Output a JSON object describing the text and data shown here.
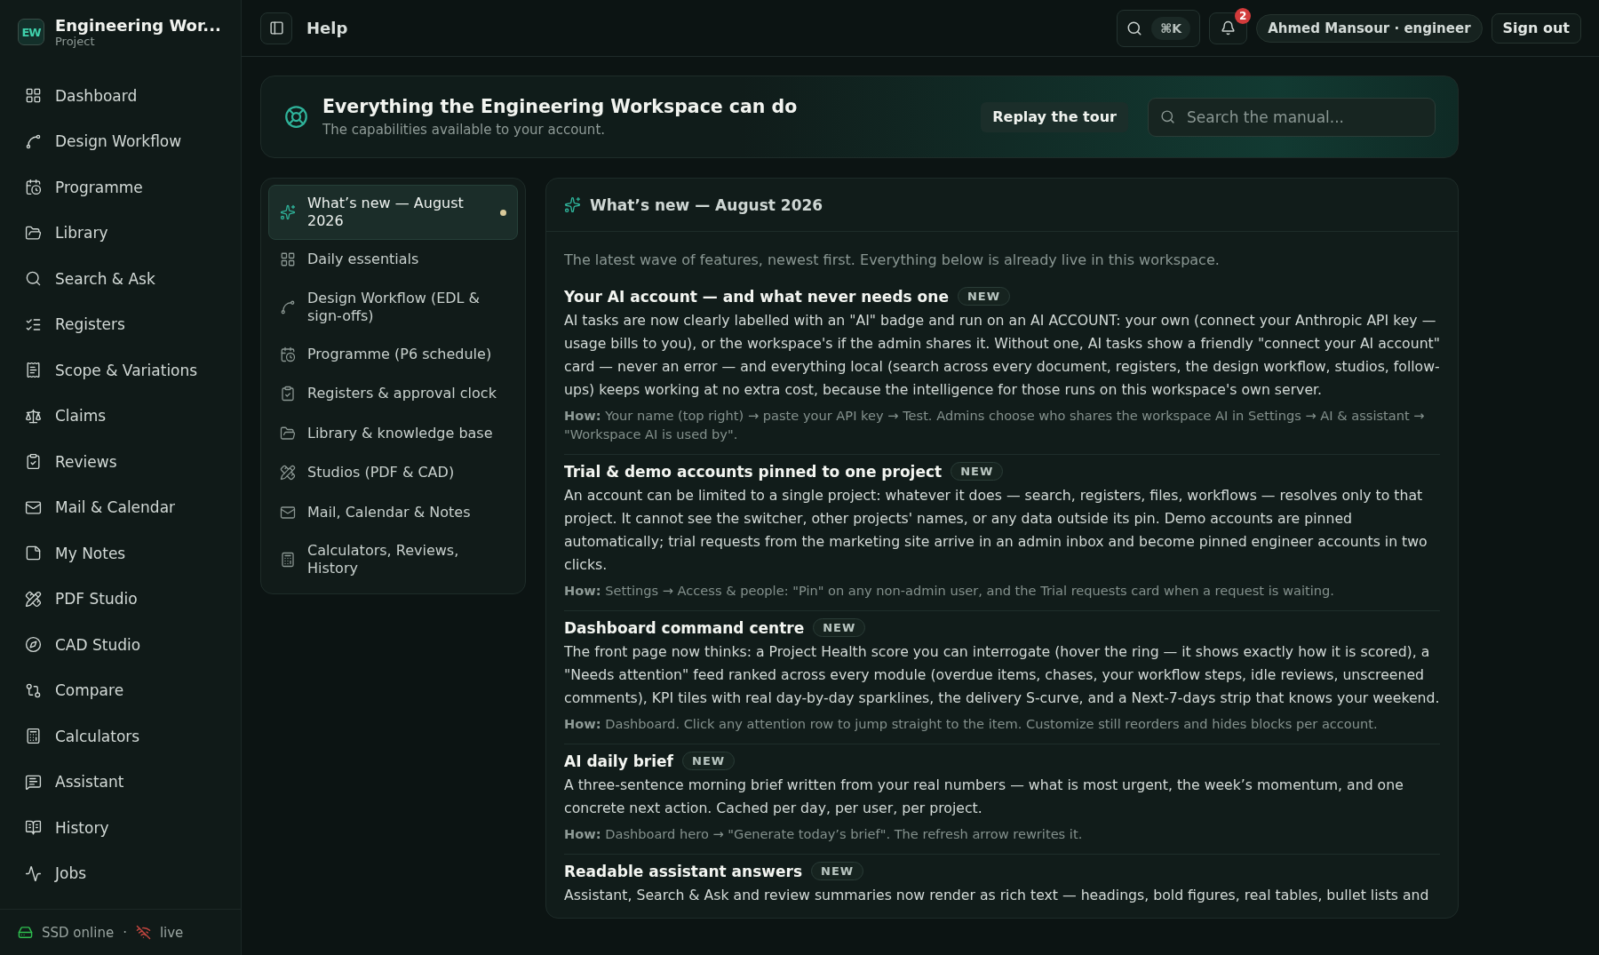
{
  "brand": {
    "initials": "EW",
    "name": "Engineering Wor...",
    "subtitle": "Project"
  },
  "sidebar": {
    "items": [
      {
        "label": "Dashboard",
        "selected": false
      },
      {
        "label": "Design Workflow",
        "selected": false
      },
      {
        "label": "Programme",
        "selected": false
      },
      {
        "label": "Library",
        "selected": false
      },
      {
        "label": "Search & Ask",
        "selected": false
      },
      {
        "label": "Registers",
        "selected": false
      },
      {
        "label": "Scope & Variations",
        "selected": false
      },
      {
        "label": "Claims",
        "selected": false
      },
      {
        "label": "Reviews",
        "selected": false
      },
      {
        "label": "Mail & Calendar",
        "selected": false
      },
      {
        "label": "My Notes",
        "selected": false
      },
      {
        "label": "PDF Studio",
        "selected": false
      },
      {
        "label": "CAD Studio",
        "selected": false
      },
      {
        "label": "Compare",
        "selected": false
      },
      {
        "label": "Calculators",
        "selected": false
      },
      {
        "label": "Assistant",
        "selected": false
      },
      {
        "label": "History",
        "selected": false
      },
      {
        "label": "Jobs",
        "selected": false
      }
    ],
    "status": {
      "storage": "SSD online",
      "storage_ok": true,
      "separator": "·",
      "live": "live",
      "live_ok": false
    }
  },
  "topbar": {
    "title": "Help",
    "shortcut": "⌘K",
    "notifications": "2",
    "user": "Ahmed Mansour · engineer",
    "sign_out": "Sign out"
  },
  "header": {
    "title": "Everything the Engineering Workspace can do",
    "subtitle": "The capabilities available to your account.",
    "button": "Replay the tour",
    "search": {
      "placeholder": "Search the manual..."
    }
  },
  "toc": [
    {
      "label": "What’s new — August 2026",
      "selected": true
    },
    {
      "label": "Daily essentials",
      "selected": false
    },
    {
      "label": "Design Workflow (EDL & sign-offs)",
      "selected": false
    },
    {
      "label": "Programme (P6 schedule)",
      "selected": false
    },
    {
      "label": "Registers & approval clock",
      "selected": false
    },
    {
      "label": "Library & knowledge base",
      "selected": false
    },
    {
      "label": "Studios (PDF & CAD)",
      "selected": false
    },
    {
      "label": "Mail, Calendar & Notes",
      "selected": false
    },
    {
      "label": "Calculators, Reviews, History",
      "selected": false
    }
  ],
  "article": {
    "title": "What’s new — August 2026",
    "intro": "The latest wave of features, newest first. Everything below is already live in this workspace.",
    "sections": [
      {
        "title": "Your AI account — and what never needs one",
        "badge": "NEW",
        "body": "AI tasks are now clearly labelled with an \"AI\" badge and run on an AI ACCOUNT: your own (connect your Anthropic API key — usage bills to you), or the workspace's if the admin shares it. Without one, AI tasks show a friendly \"connect your AI account\" card — never an error — and everything local (search across every document, registers, the design workflow, studios, follow-ups) keeps working at no extra cost, because the intelligence for those runs on this workspace's own server.",
        "how": "**How:** Your name (top right) → paste your API key → Test. Admins choose who shares the workspace AI in Settings → AI & assistant → \"Workspace AI is used by\"."
      },
      {
        "title": "Trial & demo accounts pinned to one project",
        "badge": "NEW",
        "body": "An account can be limited to a single project: whatever it does — search, registers, files, workflows — resolves only to that project. It cannot see the switcher, other projects' names, or any data outside its pin. Demo accounts are pinned automatically; trial requests from the marketing site arrive in an admin inbox and become pinned engineer accounts in two clicks.",
        "how": "**How:** Settings → Access & people: \"Pin\" on any non-admin user, and the Trial requests card when a request is waiting."
      },
      {
        "title": "Dashboard command centre",
        "badge": "NEW",
        "body": "The front page now thinks: a Project Health score you can interrogate (hover the ring — it shows exactly how it is scored), a \"Needs attention\" feed ranked across every module (overdue items, chases, your workflow steps, idle reviews, unscreened comments), KPI tiles with real day-by-day sparklines, the delivery S-curve, and a Next-7-days strip that knows your weekend.",
        "how": "**How:** Dashboard. Click any attention row to jump straight to the item. Customize still reorders and hides blocks per account."
      },
      {
        "title": "AI daily brief",
        "badge": "NEW",
        "body": "A three-sentence morning brief written from your real numbers — what is most urgent, the week’s momentum, and one concrete next action. Cached per day, per user, per project.",
        "how": "**How:** Dashboard hero → \"Generate today’s brief\". The refresh arrow rewrites it."
      },
      {
        "title": "Readable assistant answers",
        "badge": "NEW",
        "body": "Assistant, Search & Ask and review summaries now render as rich text — headings, bold figures, real tables, bullet lists and"
      }
    ]
  }
}
